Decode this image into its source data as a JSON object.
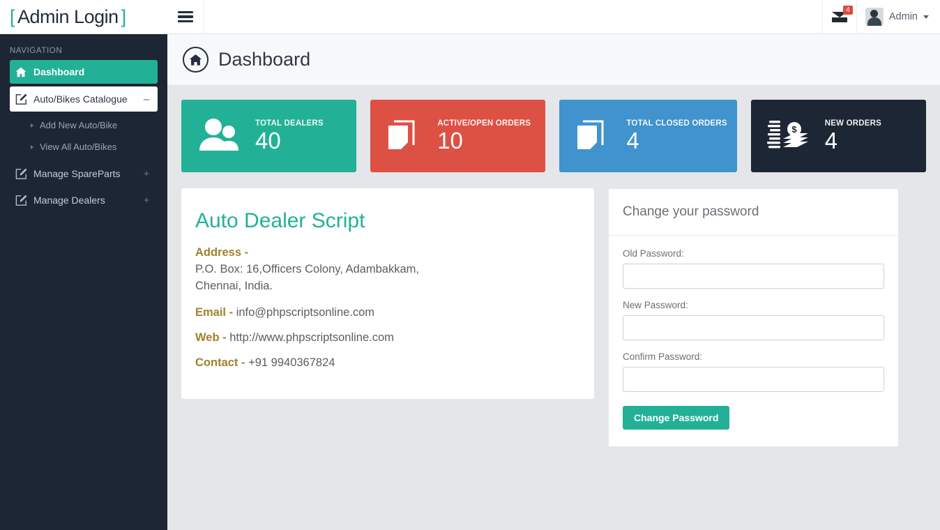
{
  "brand": {
    "bracket_left": "[",
    "text": "Admin Login",
    "bracket_right": "]"
  },
  "sidebar": {
    "nav_title": "NAVIGATION",
    "items": [
      {
        "label": "Dashboard",
        "icon": "home-icon",
        "state": "active",
        "expander": ""
      },
      {
        "label": "Auto/Bikes Catalogue",
        "icon": "pencil-square-icon",
        "state": "open",
        "expander": "–"
      },
      {
        "label": "Manage SpareParts",
        "icon": "pencil-square-icon",
        "state": "normal",
        "expander": "+"
      },
      {
        "label": "Manage Dealers",
        "icon": "pencil-square-icon",
        "state": "normal",
        "expander": "+"
      }
    ],
    "sub_items": [
      {
        "label": "Add New Auto/Bike"
      },
      {
        "label": "View All Auto/Bikes"
      }
    ]
  },
  "topbar": {
    "menu_toggle_icon": "hamburger-icon",
    "mail_icon": "envelope-icon",
    "mail_badge": "4",
    "avatar_icon": "user-avatar",
    "user_name": "Admin",
    "caret_icon": "caret-down-icon"
  },
  "page": {
    "icon": "home-circle-icon",
    "title": "Dashboard"
  },
  "cards": [
    {
      "label": "TOTAL DEALERS",
      "value": "40",
      "color": "#22b196",
      "icon": "users-icon"
    },
    {
      "label": "ACTIVE/OPEN ORDERS",
      "value": "10",
      "color": "#dd5145",
      "icon": "documents-icon"
    },
    {
      "label": "TOTAL CLOSED ORDERS",
      "value": "4",
      "color": "#4193ce",
      "icon": "documents-icon"
    },
    {
      "label": "NEW ORDERS",
      "value": "4",
      "color": "#1d2634",
      "icon": "money-icon"
    }
  ],
  "info_panel": {
    "title": "Auto Dealer Script",
    "address_label": "Address -",
    "address_line1": "P.O. Box: 16,Officers Colony, Adambakkam,",
    "address_line2": "Chennai, India.",
    "email_label": "Email -",
    "email_value": "info@phpscriptsonline.com",
    "web_label": "Web -",
    "web_value": "http://www.phpscriptsonline.com",
    "contact_label": "Contact -",
    "contact_value": "+91 9940367824"
  },
  "password_panel": {
    "heading": "Change your password",
    "old_label": "Old Password:",
    "old_value": "",
    "new_label": "New Password:",
    "new_value": "",
    "confirm_label": "Confirm Password:",
    "confirm_value": "",
    "submit_label": "Change Password"
  },
  "colors": {
    "accent_teal": "#22b196",
    "sidebar_dark": "#1d2634",
    "danger_red": "#dd5145",
    "info_blue": "#4193ce",
    "label_gold": "#a0812e"
  }
}
